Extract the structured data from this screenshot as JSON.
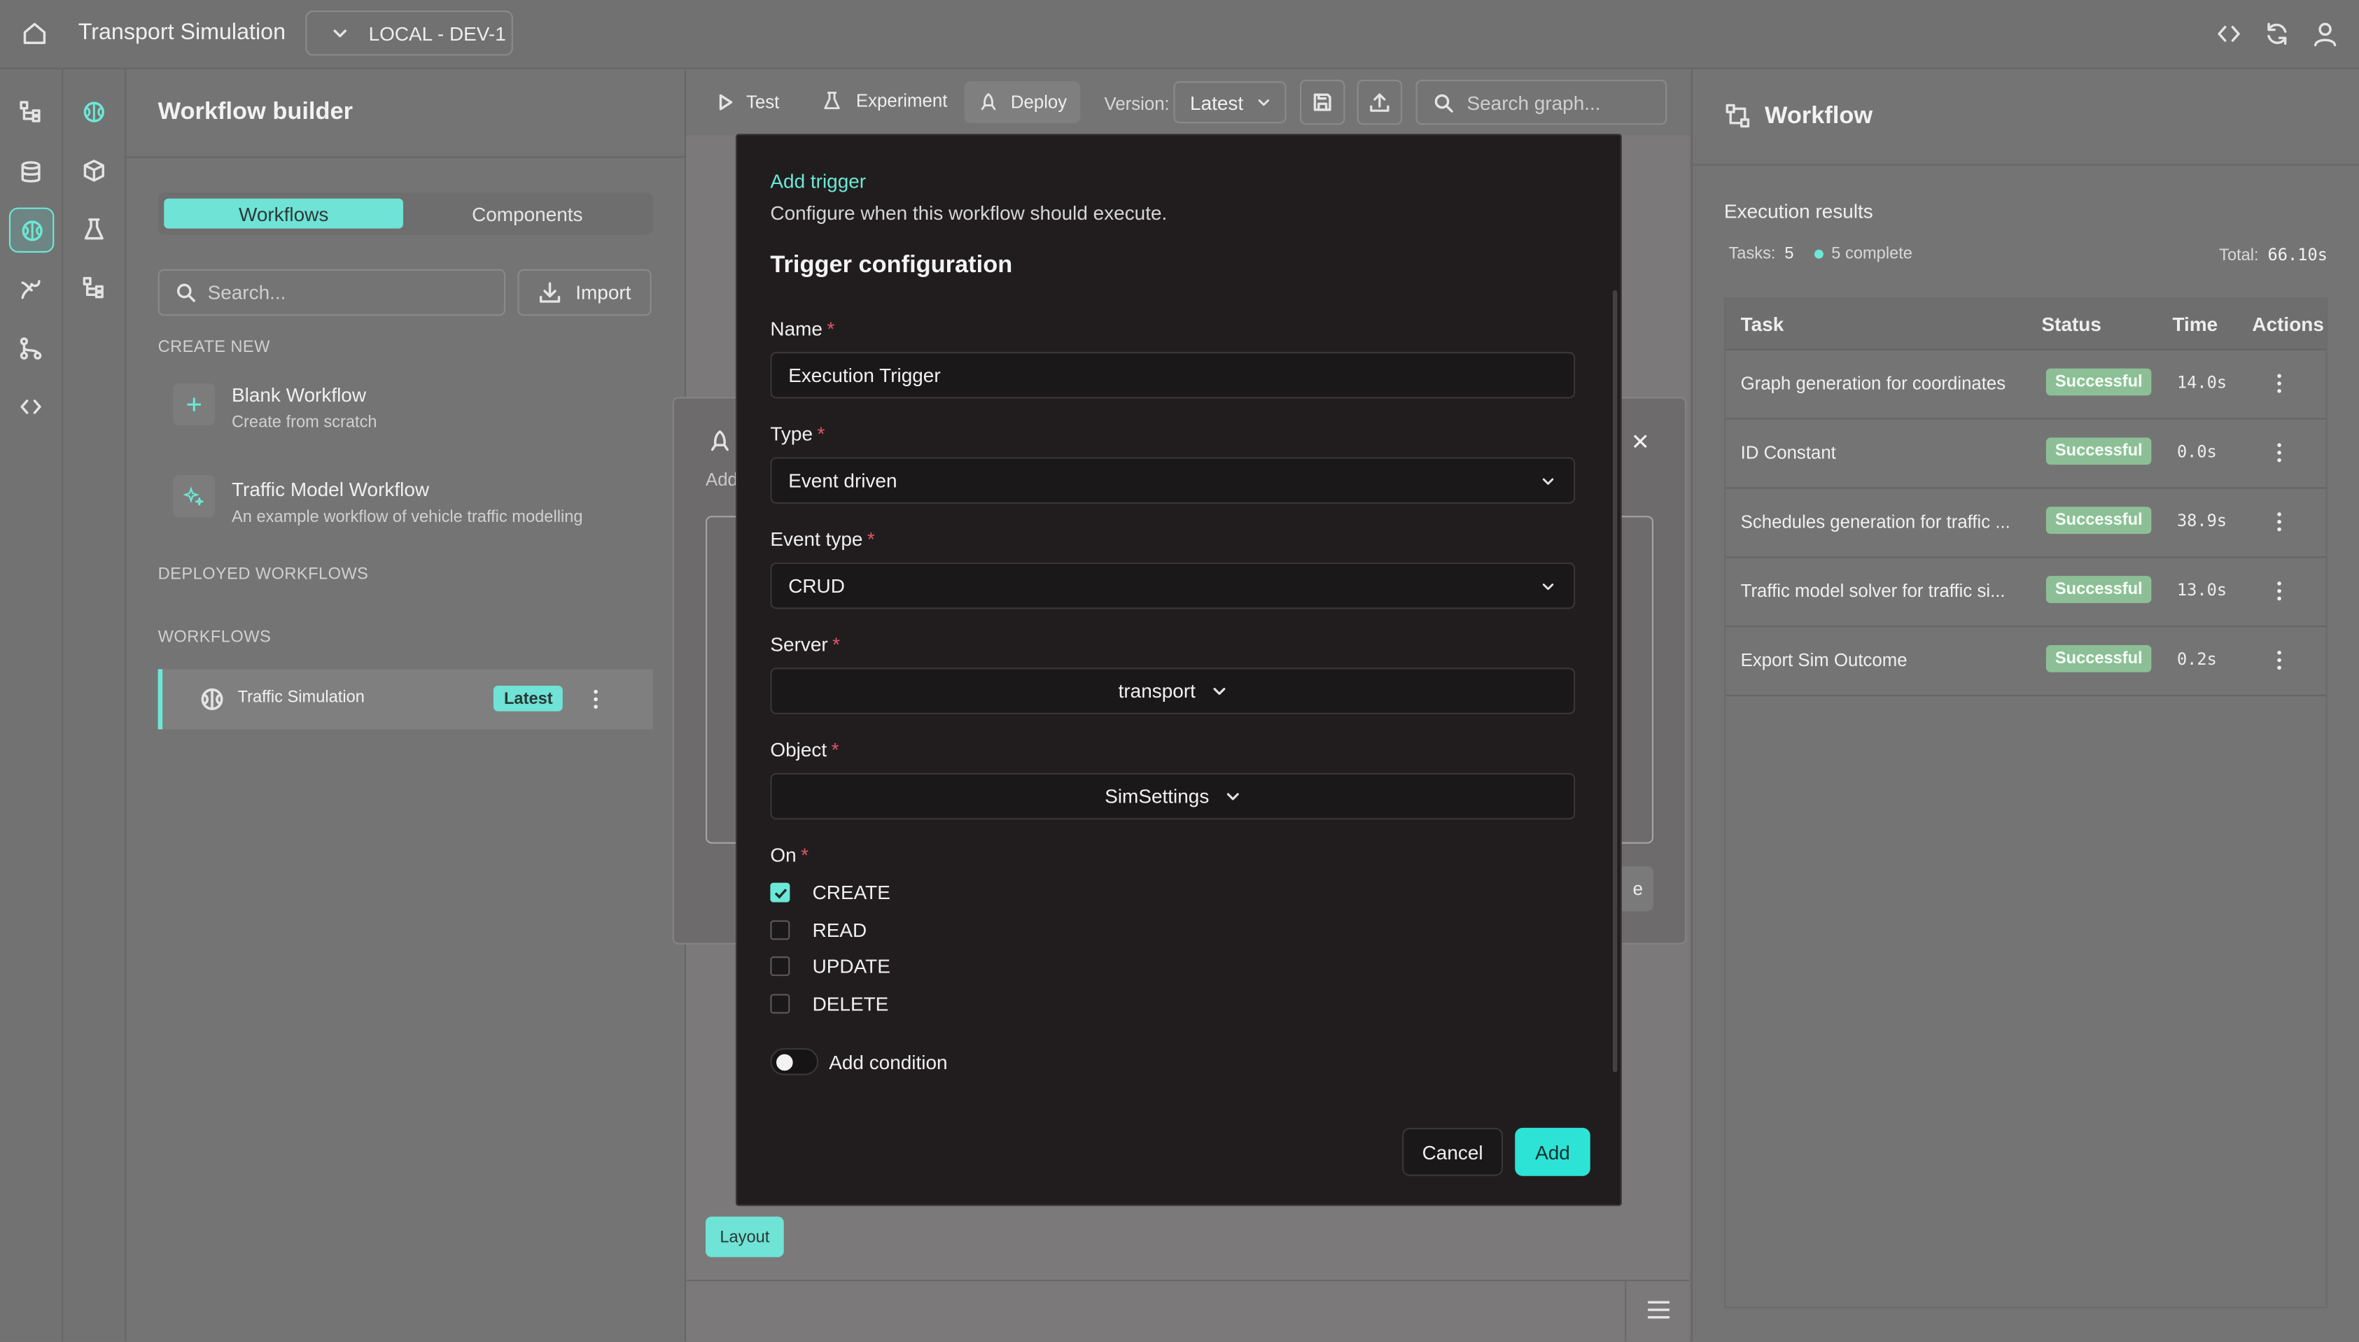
{
  "colors": {
    "accent": "#6ce8d6",
    "success_bg": "#8dbf96",
    "modal_bg": "#211d1e",
    "add_btn": "#2de3d6"
  },
  "topbar": {
    "title": "Transport Simulation",
    "env": "LOCAL - DEV-1"
  },
  "left_panel": {
    "title": "Workflow builder",
    "tabs": [
      "Workflows",
      "Components"
    ],
    "search_placeholder": "Search...",
    "import_label": "Import",
    "create_new_heading": "CREATE NEW",
    "templates": [
      {
        "title": "Blank Workflow",
        "subtitle": "Create from scratch",
        "icon": "plus-icon"
      },
      {
        "title": "Traffic Model Workflow",
        "subtitle": "An example workflow of vehicle traffic modelling",
        "icon": "sparkle-icon"
      }
    ],
    "deployed_heading": "DEPLOYED WORKFLOWS",
    "workflows_heading": "WORKFLOWS",
    "workflow_item": {
      "name": "Traffic Simulation",
      "badge": "Latest"
    }
  },
  "toolbar": {
    "test": "Test",
    "experiment": "Experiment",
    "deploy": "Deploy",
    "version_label": "Version:",
    "version_value": "Latest",
    "search_placeholder": "Search graph..."
  },
  "canvas": {
    "layout_button": "Layout",
    "behind_dialog_text": "Add",
    "behind_dialog_btn": "e"
  },
  "modal": {
    "eyebrow": "Add trigger",
    "description": "Configure when this workflow should execute.",
    "heading": "Trigger configuration",
    "name_label": "Name",
    "name_value": "Execution Trigger",
    "type_label": "Type",
    "type_value": "Event driven",
    "event_type_label": "Event type",
    "event_type_value": "CRUD",
    "server_label": "Server",
    "server_value": "transport",
    "object_label": "Object",
    "object_value": "SimSettings",
    "on_label": "On",
    "options": [
      {
        "label": "CREATE",
        "checked": true
      },
      {
        "label": "READ",
        "checked": false
      },
      {
        "label": "UPDATE",
        "checked": false
      },
      {
        "label": "DELETE",
        "checked": false
      }
    ],
    "condition_label": "Add condition",
    "cancel": "Cancel",
    "add": "Add"
  },
  "right_panel": {
    "title": "Workflow",
    "results_heading": "Execution results",
    "tasks_label": "Tasks:",
    "tasks_count": "5",
    "complete_text": "5 complete",
    "total_label": "Total:",
    "total_value": "66.10s",
    "columns": [
      "Task",
      "Status",
      "Time",
      "Actions"
    ],
    "rows": [
      {
        "task": "Graph generation for coordinates",
        "status": "Successful",
        "time": "14.0s"
      },
      {
        "task": "ID Constant",
        "status": "Successful",
        "time": "0.0s"
      },
      {
        "task": "Schedules generation for traffic ...",
        "status": "Successful",
        "time": "38.9s"
      },
      {
        "task": "Traffic model solver for traffic si...",
        "status": "Successful",
        "time": "13.0s"
      },
      {
        "task": "Export Sim Outcome",
        "status": "Successful",
        "time": "0.2s"
      }
    ]
  }
}
